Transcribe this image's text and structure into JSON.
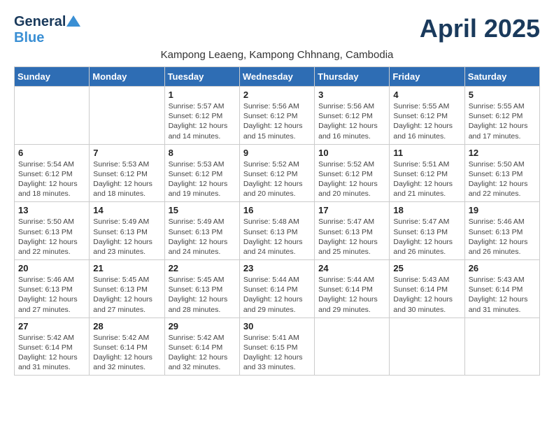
{
  "header": {
    "logo_general": "General",
    "logo_blue": "Blue",
    "month_title": "April 2025",
    "subtitle": "Kampong Leaeng, Kampong Chhnang, Cambodia"
  },
  "weekdays": [
    "Sunday",
    "Monday",
    "Tuesday",
    "Wednesday",
    "Thursday",
    "Friday",
    "Saturday"
  ],
  "weeks": [
    [
      {
        "day": "",
        "info": ""
      },
      {
        "day": "",
        "info": ""
      },
      {
        "day": "1",
        "info": "Sunrise: 5:57 AM\nSunset: 6:12 PM\nDaylight: 12 hours and 14 minutes."
      },
      {
        "day": "2",
        "info": "Sunrise: 5:56 AM\nSunset: 6:12 PM\nDaylight: 12 hours and 15 minutes."
      },
      {
        "day": "3",
        "info": "Sunrise: 5:56 AM\nSunset: 6:12 PM\nDaylight: 12 hours and 16 minutes."
      },
      {
        "day": "4",
        "info": "Sunrise: 5:55 AM\nSunset: 6:12 PM\nDaylight: 12 hours and 16 minutes."
      },
      {
        "day": "5",
        "info": "Sunrise: 5:55 AM\nSunset: 6:12 PM\nDaylight: 12 hours and 17 minutes."
      }
    ],
    [
      {
        "day": "6",
        "info": "Sunrise: 5:54 AM\nSunset: 6:12 PM\nDaylight: 12 hours and 18 minutes."
      },
      {
        "day": "7",
        "info": "Sunrise: 5:53 AM\nSunset: 6:12 PM\nDaylight: 12 hours and 18 minutes."
      },
      {
        "day": "8",
        "info": "Sunrise: 5:53 AM\nSunset: 6:12 PM\nDaylight: 12 hours and 19 minutes."
      },
      {
        "day": "9",
        "info": "Sunrise: 5:52 AM\nSunset: 6:12 PM\nDaylight: 12 hours and 20 minutes."
      },
      {
        "day": "10",
        "info": "Sunrise: 5:52 AM\nSunset: 6:12 PM\nDaylight: 12 hours and 20 minutes."
      },
      {
        "day": "11",
        "info": "Sunrise: 5:51 AM\nSunset: 6:12 PM\nDaylight: 12 hours and 21 minutes."
      },
      {
        "day": "12",
        "info": "Sunrise: 5:50 AM\nSunset: 6:13 PM\nDaylight: 12 hours and 22 minutes."
      }
    ],
    [
      {
        "day": "13",
        "info": "Sunrise: 5:50 AM\nSunset: 6:13 PM\nDaylight: 12 hours and 22 minutes."
      },
      {
        "day": "14",
        "info": "Sunrise: 5:49 AM\nSunset: 6:13 PM\nDaylight: 12 hours and 23 minutes."
      },
      {
        "day": "15",
        "info": "Sunrise: 5:49 AM\nSunset: 6:13 PM\nDaylight: 12 hours and 24 minutes."
      },
      {
        "day": "16",
        "info": "Sunrise: 5:48 AM\nSunset: 6:13 PM\nDaylight: 12 hours and 24 minutes."
      },
      {
        "day": "17",
        "info": "Sunrise: 5:47 AM\nSunset: 6:13 PM\nDaylight: 12 hours and 25 minutes."
      },
      {
        "day": "18",
        "info": "Sunrise: 5:47 AM\nSunset: 6:13 PM\nDaylight: 12 hours and 26 minutes."
      },
      {
        "day": "19",
        "info": "Sunrise: 5:46 AM\nSunset: 6:13 PM\nDaylight: 12 hours and 26 minutes."
      }
    ],
    [
      {
        "day": "20",
        "info": "Sunrise: 5:46 AM\nSunset: 6:13 PM\nDaylight: 12 hours and 27 minutes."
      },
      {
        "day": "21",
        "info": "Sunrise: 5:45 AM\nSunset: 6:13 PM\nDaylight: 12 hours and 27 minutes."
      },
      {
        "day": "22",
        "info": "Sunrise: 5:45 AM\nSunset: 6:13 PM\nDaylight: 12 hours and 28 minutes."
      },
      {
        "day": "23",
        "info": "Sunrise: 5:44 AM\nSunset: 6:14 PM\nDaylight: 12 hours and 29 minutes."
      },
      {
        "day": "24",
        "info": "Sunrise: 5:44 AM\nSunset: 6:14 PM\nDaylight: 12 hours and 29 minutes."
      },
      {
        "day": "25",
        "info": "Sunrise: 5:43 AM\nSunset: 6:14 PM\nDaylight: 12 hours and 30 minutes."
      },
      {
        "day": "26",
        "info": "Sunrise: 5:43 AM\nSunset: 6:14 PM\nDaylight: 12 hours and 31 minutes."
      }
    ],
    [
      {
        "day": "27",
        "info": "Sunrise: 5:42 AM\nSunset: 6:14 PM\nDaylight: 12 hours and 31 minutes."
      },
      {
        "day": "28",
        "info": "Sunrise: 5:42 AM\nSunset: 6:14 PM\nDaylight: 12 hours and 32 minutes."
      },
      {
        "day": "29",
        "info": "Sunrise: 5:42 AM\nSunset: 6:14 PM\nDaylight: 12 hours and 32 minutes."
      },
      {
        "day": "30",
        "info": "Sunrise: 5:41 AM\nSunset: 6:15 PM\nDaylight: 12 hours and 33 minutes."
      },
      {
        "day": "",
        "info": ""
      },
      {
        "day": "",
        "info": ""
      },
      {
        "day": "",
        "info": ""
      }
    ]
  ]
}
